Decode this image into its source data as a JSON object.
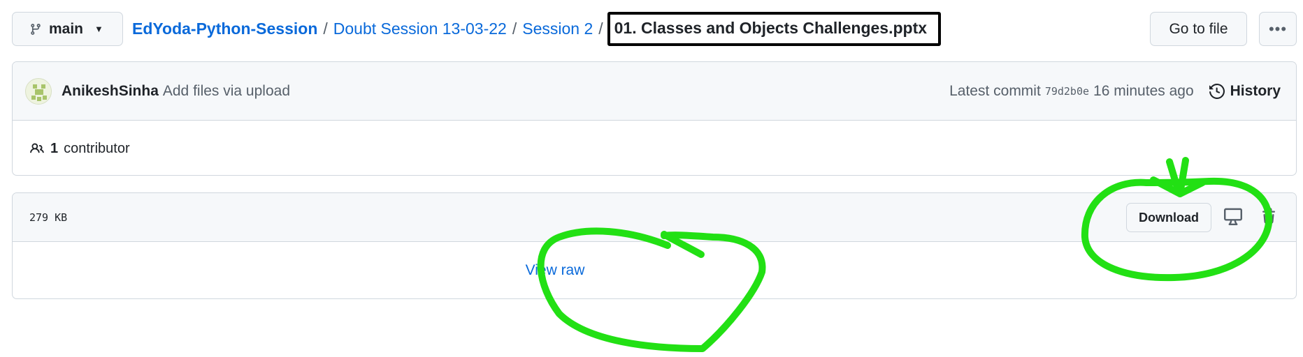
{
  "branch": {
    "icon": "git-branch-icon",
    "label": "main"
  },
  "breadcrumb": {
    "repo": "EdYoda-Python-Session",
    "folder1": "Doubt Session 13-03-22",
    "folder2": "Session 2",
    "separator": "/",
    "file": "01. Classes and Objects Challenges.pptx"
  },
  "actions": {
    "go_to_file": "Go to file",
    "more_icon": "kebab-horizontal-icon"
  },
  "commit": {
    "author": "AnikeshSinha",
    "message": "Add files via upload",
    "latest_label": "Latest commit",
    "sha": "79d2b0e",
    "time": "16 minutes ago",
    "history": "History"
  },
  "contributors": {
    "count": "1",
    "label": "contributor"
  },
  "file": {
    "size": "279 KB",
    "download": "Download",
    "view_raw": "View raw"
  },
  "colors": {
    "link": "#0969da",
    "annotation": "#22e014",
    "border": "#d0d7de"
  }
}
